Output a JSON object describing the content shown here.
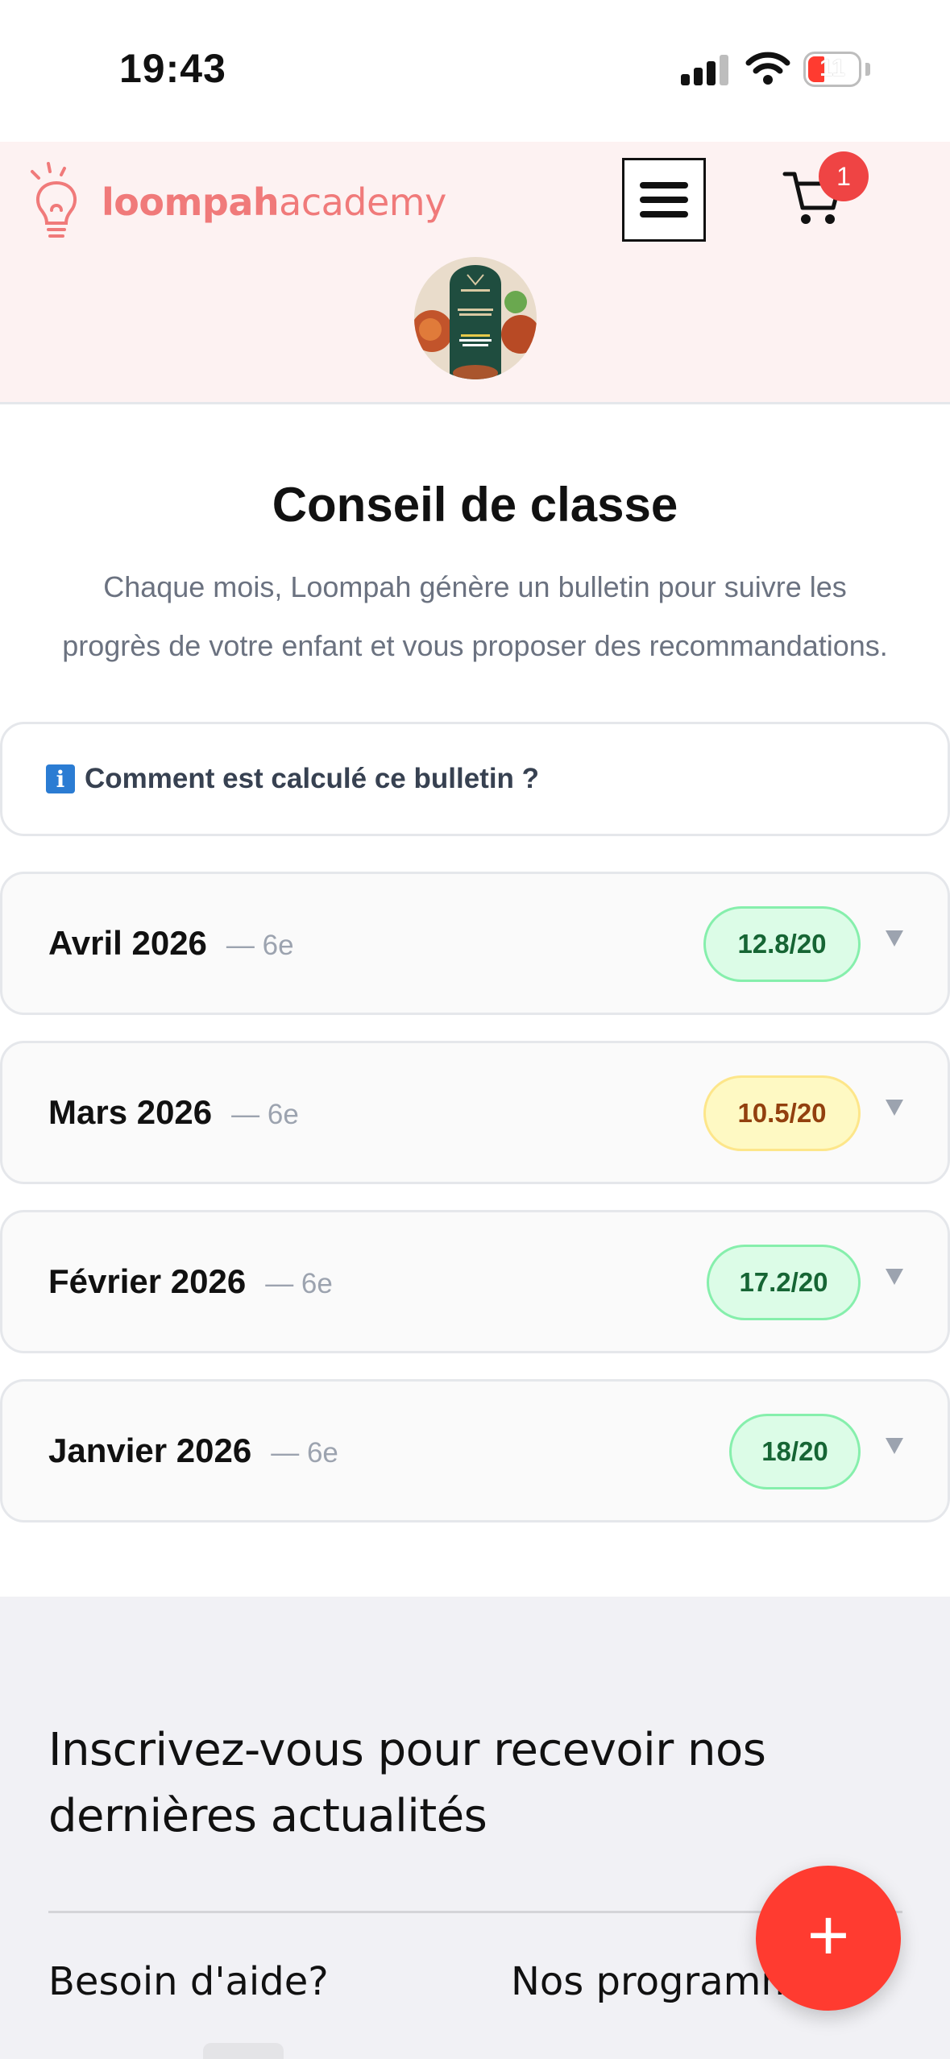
{
  "status_bar": {
    "time": "19:43",
    "battery": "11"
  },
  "header": {
    "logo_bold": "loompah",
    "logo_light": "academy",
    "cart_count": "1",
    "avatar_alt": "avatar"
  },
  "main": {
    "title": "Conseil de classe",
    "intro_line1": "Chaque mois, Loompah génère un bulletin pour suivre les",
    "intro_line2": "progrès de votre enfant et vous proposer des recommandations.",
    "info_icon": "i",
    "info_label": "Comment est calculé ce bulletin ?",
    "reports": [
      {
        "month": "Avril 2026",
        "level": "— 6e",
        "score": "12.8/20",
        "status": "green"
      },
      {
        "month": "Mars 2026",
        "level": "— 6e",
        "score": "10.5/20",
        "status": "yellow"
      },
      {
        "month": "Février 2026",
        "level": "— 6e",
        "score": "17.2/20",
        "status": "green"
      },
      {
        "month": "Janvier 2026",
        "level": "— 6e",
        "score": "18/20",
        "status": "green"
      }
    ]
  },
  "footer": {
    "newsletter_line1": "Inscrivez-vous pour recevoir nos",
    "newsletter_line2": "dernières actualités",
    "help_label": "Besoin d'aide?",
    "programs_label": "Nos programmes",
    "fab_label": "+"
  },
  "colors": {
    "brand": "#f07a7a",
    "header_bg": "#fdf2f2",
    "badge_green": "#dcfce7",
    "badge_yellow": "#fef9c3",
    "fab": "#ff3b30"
  },
  "icons": [
    "signal-icon",
    "wifi-icon",
    "battery-icon",
    "lightbulb-logo-icon",
    "menu-icon",
    "cart-icon",
    "info-icon",
    "chevron-down-icon",
    "plus-icon"
  ]
}
